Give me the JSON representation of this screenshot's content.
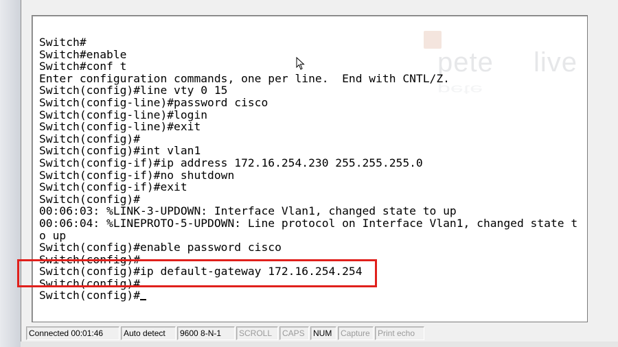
{
  "terminal": {
    "lines": [
      "Switch#",
      "Switch#enable",
      "Switch#conf t",
      "Enter configuration commands, one per line.  End with CNTL/Z.",
      "Switch(config)#line vty 0 15",
      "Switch(config-line)#password cisco",
      "Switch(config-line)#login",
      "Switch(config-line)#exit",
      "Switch(config)#",
      "Switch(config)#int vlan1",
      "Switch(config-if)#ip address 172.16.254.230 255.255.255.0",
      "Switch(config-if)#no shutdown",
      "Switch(config-if)#exit",
      "Switch(config)#",
      "00:06:03: %LINK-3-UPDOWN: Interface Vlan1, changed state to up",
      "00:06:04: %LINEPROTO-5-UPDOWN: Line protocol on Interface Vlan1, changed state t",
      "o up",
      "Switch(config)#enable password cisco",
      "Switch(config)#",
      "Switch(config)#ip default-gateway 172.16.254.254",
      "Switch(config)#",
      "Switch(config)#"
    ],
    "highlighted_line": "Switch(config)#ip default-gateway 172.16.254.254",
    "highlight_color": "#e0201c"
  },
  "watermark": {
    "left_word": "pete",
    "right_word": "live",
    "brand_color": "#c97a52"
  },
  "status_bar": {
    "connected": "Connected 00:01:46",
    "auto_detect": "Auto detect",
    "baud": "9600 8-N-1",
    "scroll": "SCROLL",
    "caps": "CAPS",
    "num": "NUM",
    "capture": "Capture",
    "print_echo": "Print echo"
  }
}
